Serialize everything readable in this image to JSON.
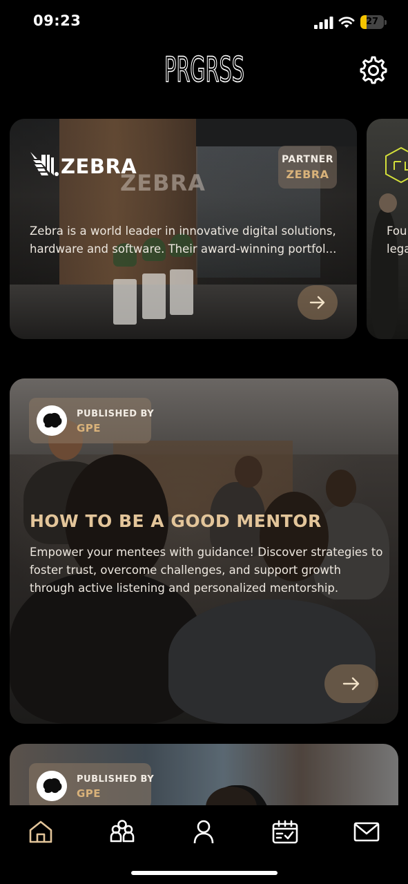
{
  "status_bar": {
    "time": "09:23",
    "battery_level": "27",
    "battery_percent": 27,
    "battery_color": "#f5c400"
  },
  "header": {
    "logo_text": "PRGRSS",
    "settings_icon": "gear-icon"
  },
  "partner_card": {
    "brand_name": "ZEBRA",
    "badge_label": "PARTNER",
    "badge_value": "ZEBRA",
    "description": "Zebra is a world leader in innovative digital solutions, hardware and software. Their award-winning portfol...",
    "wall_sign": "ZEBRA",
    "arrow_icon": "arrow-right-icon"
  },
  "peek_card": {
    "text_line1": "Fou",
    "text_line2": "lega"
  },
  "article_card": {
    "published_by_label": "PUBLISHED BY",
    "publisher": "GPE",
    "title": "HOW TO BE A GOOD MENTOR",
    "description": "Empower your mentees with guidance! Discover strategies to foster trust, overcome challenges, and support growth through active listening and personalized mentorship.",
    "arrow_icon": "arrow-right-icon"
  },
  "third_card": {
    "published_by_label": "PUBLISHED BY",
    "publisher": "GPE"
  },
  "bottom_nav": {
    "items": [
      {
        "icon": "home-icon",
        "active": true
      },
      {
        "icon": "community-icon",
        "active": false
      },
      {
        "icon": "profile-icon",
        "active": false
      },
      {
        "icon": "calendar-icon",
        "active": false
      },
      {
        "icon": "mail-icon",
        "active": false
      }
    ],
    "active_color": "#e3c59a"
  }
}
